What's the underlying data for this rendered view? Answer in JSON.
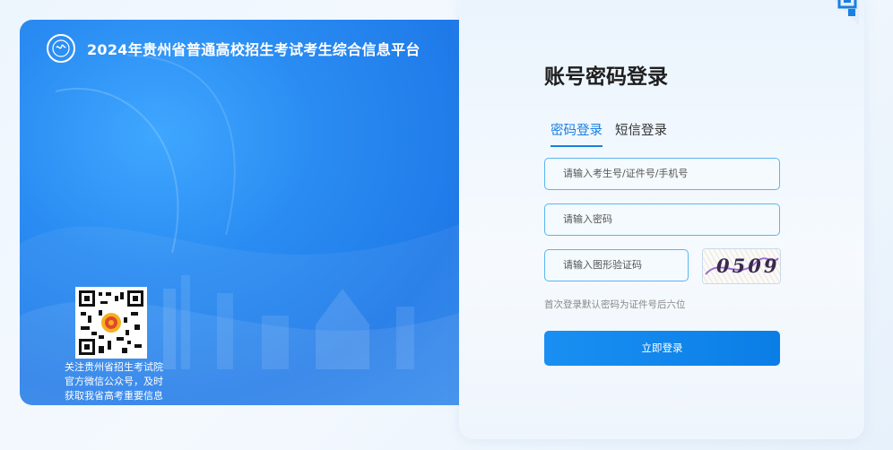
{
  "header": {
    "platform_title": "2024年贵州省普通高校招生考试考生综合信息平台"
  },
  "qr_caption": [
    "关注贵州省招生考试院",
    "官方微信公众号，及时",
    "获取我省高考重要信息"
  ],
  "login": {
    "heading": "账号密码登录",
    "tabs": [
      {
        "label": "密码登录",
        "active": true
      },
      {
        "label": "短信登录",
        "active": false
      }
    ],
    "account_placeholder": "请输入考生号/证件号/手机号",
    "password_placeholder": "请输入密码",
    "captcha_placeholder": "请输入图形验证码",
    "captcha_text": "0509",
    "hint": "首次登录默认密码为证件号后六位",
    "submit_label": "立即登录"
  },
  "colors": {
    "accent": "#1a7fe0",
    "panel_blue": "#2a8cf2",
    "button": "#0a7ee6"
  }
}
